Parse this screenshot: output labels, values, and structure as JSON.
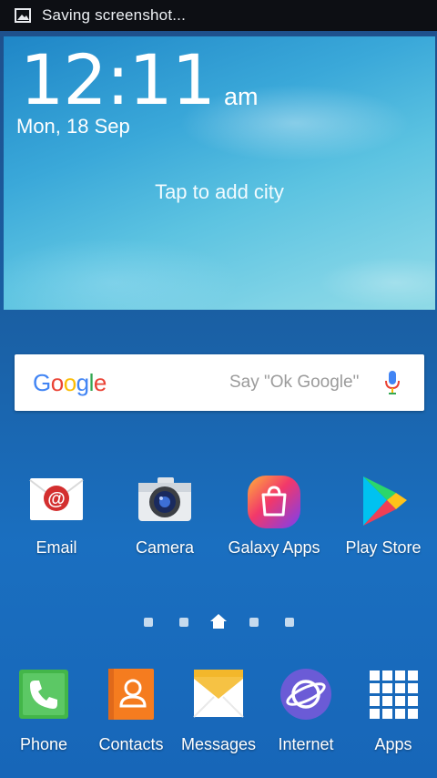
{
  "status_bar": {
    "notification": "Saving screenshot..."
  },
  "widget": {
    "time": "12:11",
    "ampm": "am",
    "date": "Mon, 18 Sep",
    "city_prompt": "Tap to add city"
  },
  "search": {
    "logo": "Google",
    "hint": "Say \"Ok Google\""
  },
  "apps": [
    {
      "label": "Email",
      "icon": "email-icon"
    },
    {
      "label": "Camera",
      "icon": "camera-icon"
    },
    {
      "label": "Galaxy Apps",
      "icon": "galaxy-apps-icon"
    },
    {
      "label": "Play Store",
      "icon": "play-store-icon"
    }
  ],
  "page_indicator": {
    "pages": 5,
    "current": 3
  },
  "dock": [
    {
      "label": "Phone",
      "icon": "phone-icon"
    },
    {
      "label": "Contacts",
      "icon": "contacts-icon"
    },
    {
      "label": "Messages",
      "icon": "messages-icon"
    },
    {
      "label": "Internet",
      "icon": "internet-icon"
    },
    {
      "label": "Apps",
      "icon": "apps-grid-icon"
    }
  ],
  "colors": {
    "email_red": "#d32f2f",
    "phone_green": "#43b649",
    "contacts_orange": "#f57c1f",
    "messages_yellow": "#f6c244",
    "internet_purple": "#6b5bd6"
  }
}
